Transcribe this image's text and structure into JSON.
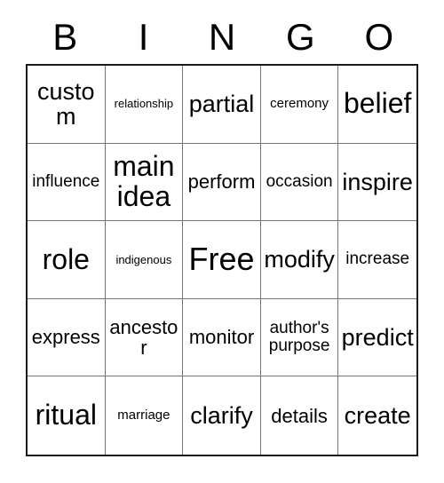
{
  "card": {
    "header_letters": [
      "B",
      "I",
      "N",
      "G",
      "O"
    ],
    "rows": [
      [
        {
          "text": "custom",
          "size": "md"
        },
        {
          "text": "relationship",
          "size": "min"
        },
        {
          "text": "partial",
          "size": "md"
        },
        {
          "text": "ceremony",
          "size": "xxs"
        },
        {
          "text": "belief",
          "size": "lg"
        }
      ],
      [
        {
          "text": "influence",
          "size": "xs"
        },
        {
          "text": "main\nidea",
          "size": "lg"
        },
        {
          "text": "perform",
          "size": "sm"
        },
        {
          "text": "occasion",
          "size": "xs"
        },
        {
          "text": "inspire",
          "size": "md"
        }
      ],
      [
        {
          "text": "role",
          "size": "lg"
        },
        {
          "text": "indigenous",
          "size": "min"
        },
        {
          "text": "Free",
          "size": "xl"
        },
        {
          "text": "modify",
          "size": "md"
        },
        {
          "text": "increase",
          "size": "xs"
        }
      ],
      [
        {
          "text": "express",
          "size": "sm"
        },
        {
          "text": "ancestor",
          "size": "sm"
        },
        {
          "text": "monitor",
          "size": "sm"
        },
        {
          "text": "author's\npurpose",
          "size": "xs"
        },
        {
          "text": "predict",
          "size": "md"
        }
      ],
      [
        {
          "text": "ritual",
          "size": "lg"
        },
        {
          "text": "marriage",
          "size": "xxs"
        },
        {
          "text": "clarify",
          "size": "md"
        },
        {
          "text": "details",
          "size": "sm"
        },
        {
          "text": "create",
          "size": "md"
        }
      ]
    ],
    "free_space": {
      "row": 2,
      "col": 2,
      "label": "Free"
    },
    "colors": {
      "background": "#ffffff",
      "text": "#000000",
      "outer_border": "#1a1a1a",
      "inner_grid_line": "#767676"
    }
  }
}
